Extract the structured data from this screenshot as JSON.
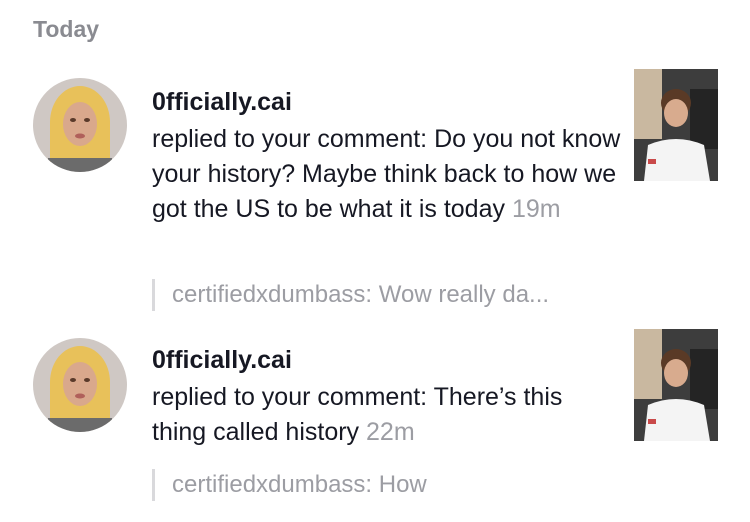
{
  "section": {
    "title": "Today"
  },
  "notifications": [
    {
      "avatar_icon": "user-avatar-blonde",
      "username": "0fficially.cai",
      "message": "replied to your comment: Do you not know your history? Maybe think back to how we got the US to be what it is today",
      "time": "19m",
      "quote": "certifiedxdumbass: Wow really da...",
      "thumbnail_icon": "video-thumbnail"
    },
    {
      "avatar_icon": "user-avatar-blonde",
      "username": "0fficially.cai",
      "message": "replied to your comment: There’s this thing called history",
      "time": "22m",
      "quote": "certifiedxdumbass: How",
      "thumbnail_icon": "video-thumbnail"
    }
  ],
  "colors": {
    "primary_text": "#161823",
    "secondary_text": "#9c9da3",
    "header_text": "#8a8b91",
    "quote_border": "#d9d9dc"
  }
}
